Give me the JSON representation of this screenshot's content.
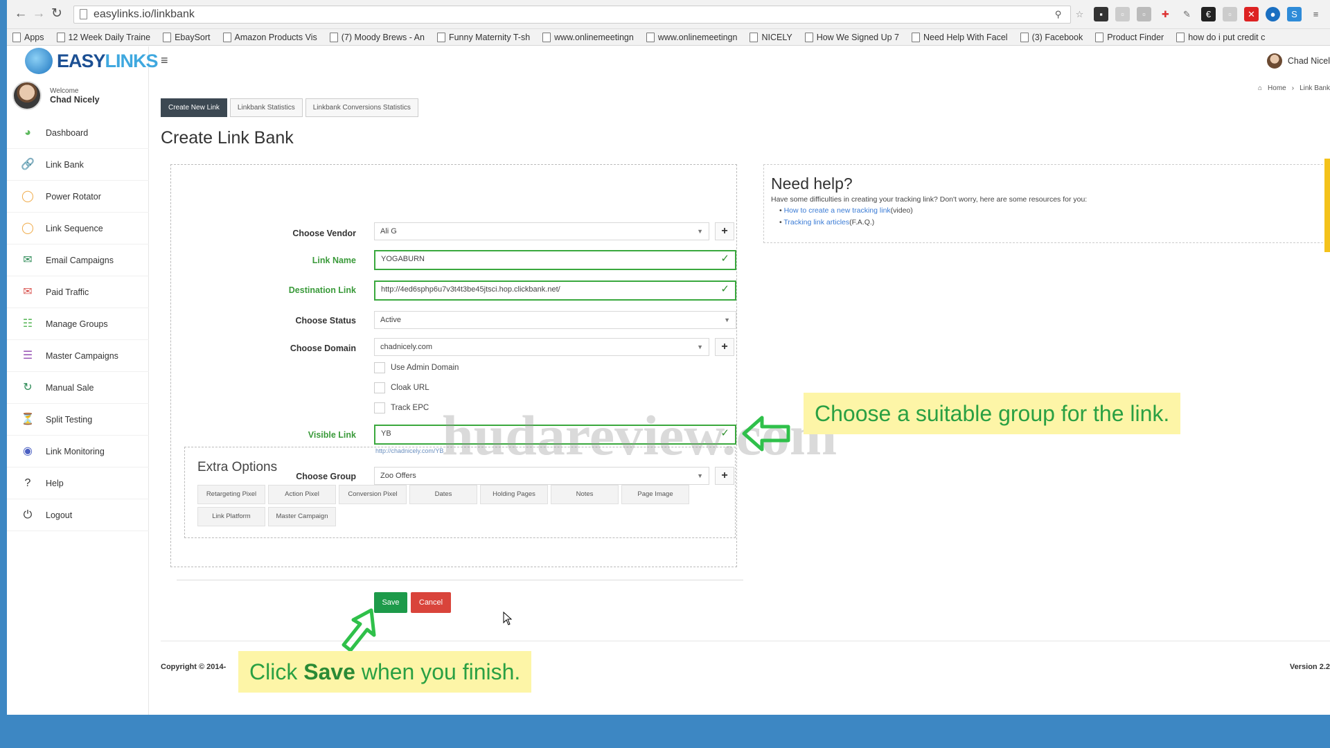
{
  "browser": {
    "url": "easylinks.io/linkbank",
    "bookmarks": [
      "Apps",
      "12 Week Daily Traine",
      "EbaySort",
      "Amazon Products Vis",
      "(7) Moody Brews - An",
      "Funny Maternity T-sh",
      "www.onlinemeetingn",
      "www.onlinemeetingn",
      "NICELY",
      "How We Signed Up 7",
      "Need Help With Facel",
      "(3) Facebook",
      "Product Finder",
      "how do i put credit c"
    ]
  },
  "app": {
    "logo_text": "EASY",
    "logo_text2": "LINKS",
    "welcome_label": "Welcome",
    "user_name": "Chad Nicely",
    "topbar_user": "Chad Nicel",
    "breadcrumb": [
      "Home",
      "Link Bank"
    ]
  },
  "sidebar": {
    "items": [
      {
        "label": "Dashboard",
        "icon": "dashboard-icon",
        "color": "#5cb85c"
      },
      {
        "label": "Link Bank",
        "icon": "link-icon",
        "color": "#5bc0de"
      },
      {
        "label": "Power Rotator",
        "icon": "circle-icon",
        "color": "#f0ad4e"
      },
      {
        "label": "Link Sequence",
        "icon": "circle-icon",
        "color": "#f0ad4e"
      },
      {
        "label": "Email Campaigns",
        "icon": "envelope-icon",
        "color": "#2e8b57"
      },
      {
        "label": "Paid Traffic",
        "icon": "envelope-outline-icon",
        "color": "#d9534f"
      },
      {
        "label": "Manage Groups",
        "icon": "groups-icon",
        "color": "#5cb85c"
      },
      {
        "label": "Master Campaigns",
        "icon": "list-icon",
        "color": "#9b59b6"
      },
      {
        "label": "Manual Sale",
        "icon": "refresh-icon",
        "color": "#2e8b57"
      },
      {
        "label": "Split Testing",
        "icon": "filter-icon",
        "color": "#5bc0de"
      },
      {
        "label": "Link Monitoring",
        "icon": "globe-icon",
        "color": "#4a5fc1"
      },
      {
        "label": "Help",
        "icon": "question-icon",
        "color": "#333333"
      },
      {
        "label": "Logout",
        "icon": "power-icon",
        "color": "#333333"
      }
    ]
  },
  "tabs": [
    "Create New Link",
    "Linkbank Statistics",
    "Linkbank Conversions Statistics"
  ],
  "page_title": "Create Link Bank",
  "form": {
    "vendor": {
      "label": "Choose Vendor",
      "value": "Ali G"
    },
    "link_name": {
      "label": "Link Name",
      "value": "YOGABURN"
    },
    "destination": {
      "label": "Destination Link",
      "value": "http://4ed6sphp6u7v3t4t3be45jtsci.hop.clickbank.net/"
    },
    "status": {
      "label": "Choose Status",
      "value": "Active"
    },
    "domain": {
      "label": "Choose Domain",
      "value": "chadnicely.com"
    },
    "checkboxes": [
      "Use Admin Domain",
      "Cloak URL",
      "Track EPC"
    ],
    "visible_link": {
      "label": "Visible Link",
      "value": "YB",
      "hint": "http://chadnicely.com/YB"
    },
    "group": {
      "label": "Choose Group",
      "value": "Zoo Offers"
    }
  },
  "extra": {
    "title": "Extra Options",
    "buttons_row1": [
      "Retargeting Pixel",
      "Action Pixel",
      "Conversion Pixel",
      "Dates",
      "Holding Pages",
      "Notes",
      "Page Image"
    ],
    "buttons_row2": [
      "Link Platform",
      "Master Campaign"
    ]
  },
  "actions": {
    "save": "Save",
    "cancel": "Cancel"
  },
  "help": {
    "title": "Need help?",
    "text": "Have some difficulties in creating your tracking link? Don't worry, here are some resources for you:",
    "links": [
      {
        "link": "How to create a new tracking link",
        "suffix": "(video)"
      },
      {
        "link": "Tracking link articles",
        "suffix": "(F.A.Q.)"
      }
    ]
  },
  "footer": {
    "copyright": "Copyright © 2014-",
    "version": "Version 2.2"
  },
  "overlay": {
    "watermark": "hudareview.com",
    "callout_group": "Choose a suitable group for the link.",
    "callout_save_pre": "Click ",
    "callout_save_bold": "Save",
    "callout_save_post": " when you finish."
  },
  "colors": {
    "accent": "#39a83d",
    "callout_bg": "#fdf5a7",
    "callout_text": "#2aa043",
    "save": "#1d9a4a",
    "cancel": "#d9443b"
  }
}
